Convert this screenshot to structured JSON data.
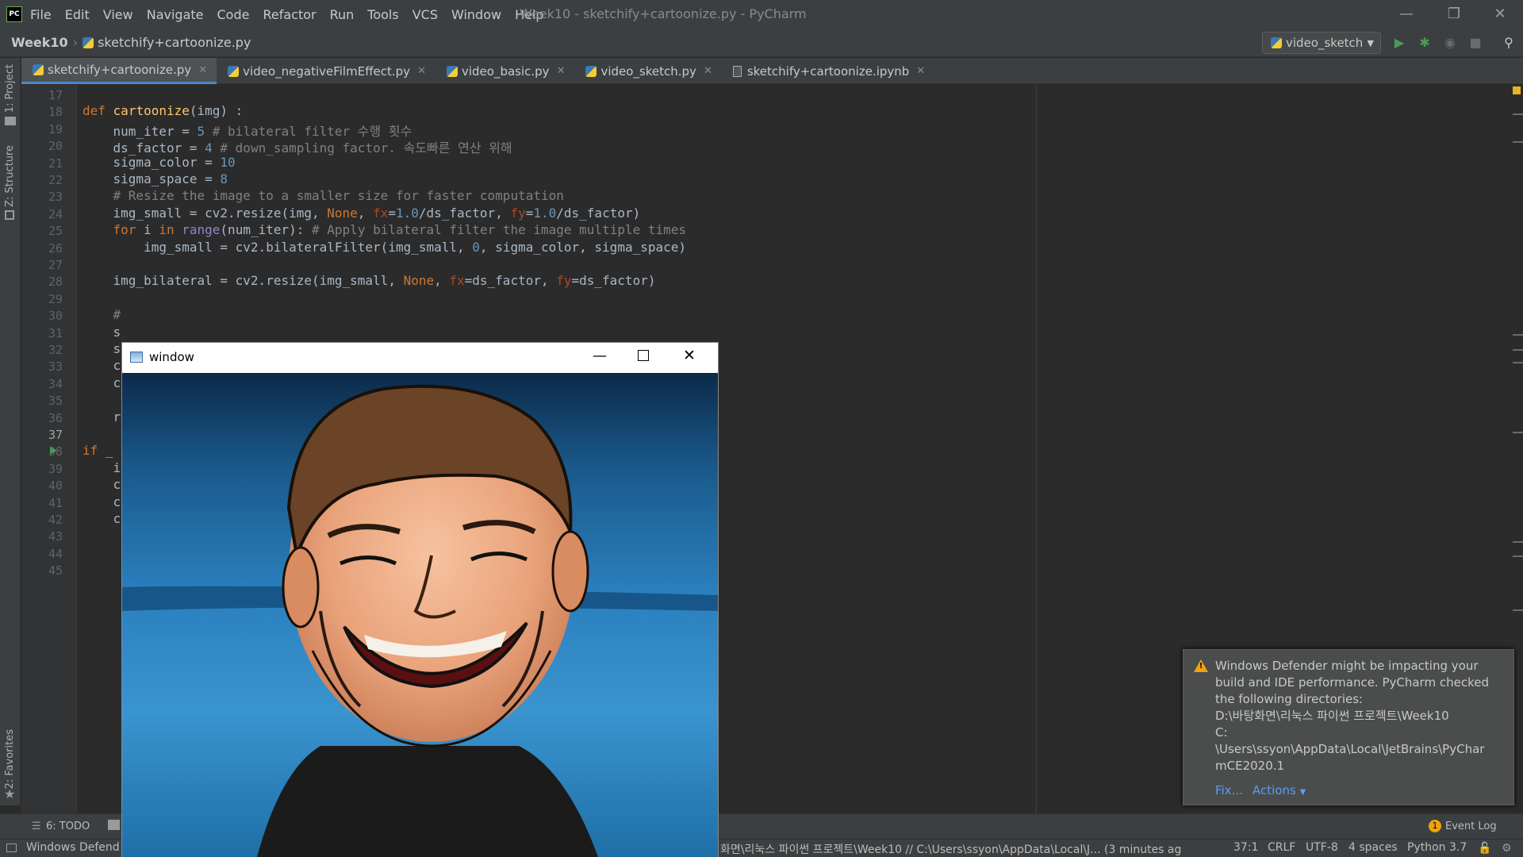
{
  "app": {
    "menu": [
      "File",
      "Edit",
      "View",
      "Navigate",
      "Code",
      "Refactor",
      "Run",
      "Tools",
      "VCS",
      "Window",
      "Help"
    ],
    "window_title": "Week10 - sketchify+cartoonize.py - PyCharm"
  },
  "nav": {
    "project": "Week10",
    "file": "sketchify+cartoonize.py",
    "run_config": "video_sketch"
  },
  "left_strip": {
    "project_label": "1: Project",
    "structure_label": "Z: Structure",
    "favorites_label": "2: Favorites"
  },
  "tabs": [
    {
      "label": "sketchify+cartoonize.py",
      "active": true
    },
    {
      "label": "video_negativeFilmEffect.py",
      "active": false
    },
    {
      "label": "video_basic.py",
      "active": false
    },
    {
      "label": "video_sketch.py",
      "active": false
    },
    {
      "label": "sketchify+cartoonize.ipynb",
      "active": false
    }
  ],
  "editor": {
    "line_numbers": [
      "17",
      "18",
      "19",
      "20",
      "21",
      "22",
      "23",
      "24",
      "25",
      "26",
      "27",
      "28",
      "29",
      "30",
      "31",
      "32",
      "33",
      "34",
      "35",
      "36",
      "37",
      "38",
      "39",
      "40",
      "41",
      "42",
      "43",
      "44",
      "45"
    ],
    "lines": [
      "",
      "def cartoonize(img) :",
      "    num_iter = 5 # bilateral filter 수행 횟수",
      "    ds_factor = 4 # down_sampling factor. 속도빠른 연산 위해",
      "    sigma_color = 10",
      "    sigma_space = 8",
      "    # Resize the image to a smaller size for faster computation",
      "    img_small = cv2.resize(img, None, fx=1.0/ds_factor, fy=1.0/ds_factor)",
      "    for i in range(num_iter): # Apply bilateral filter the image multiple times",
      "        img_small = cv2.bilateralFilter(img_small, 0, sigma_color, sigma_space)",
      "",
      "    img_bilateral = cv2.resize(img_small, None, fx=ds_factor, fy=ds_factor)",
      "",
      "    #",
      "    s",
      "    s",
      "    c",
      "    c",
      "",
      "    r",
      "",
      "if _",
      "    i",
      "    c",
      "    c",
      "    c",
      "",
      "",
      ""
    ]
  },
  "bottom_tools": {
    "todo": "6: TODO"
  },
  "status": {
    "left_text": "Windows Defend",
    "path_text": "화면\\리눅스 파이썬 프로젝트\\Week10 // C:\\Users\\ssyon\\AppData\\Local\\J... (3 minutes ag",
    "position": "37:1",
    "line_sep": "CRLF",
    "encoding": "UTF-8",
    "indent": "4 spaces",
    "interpreter": "Python 3.7",
    "event_log": "Event Log",
    "event_count": "1"
  },
  "notification": {
    "message": "Windows Defender might be impacting your build and IDE performance. PyCharm checked the following directories:",
    "dir1": "D:\\바탕화면\\리눅스 파이썬 프로젝트\\Week10",
    "dir2_a": "C:",
    "dir2_b": "\\Users\\ssyon\\AppData\\Local\\JetBrains\\PyCharmCE2020.1",
    "fix": "Fix...",
    "actions": "Actions"
  },
  "cv_window": {
    "title": "window"
  },
  "colors": {
    "accent": "#4a88c7",
    "keyword": "#cc7832",
    "function": "#ffc66d",
    "number": "#6897bb",
    "comment": "#808080",
    "warning": "#f0a30a"
  }
}
